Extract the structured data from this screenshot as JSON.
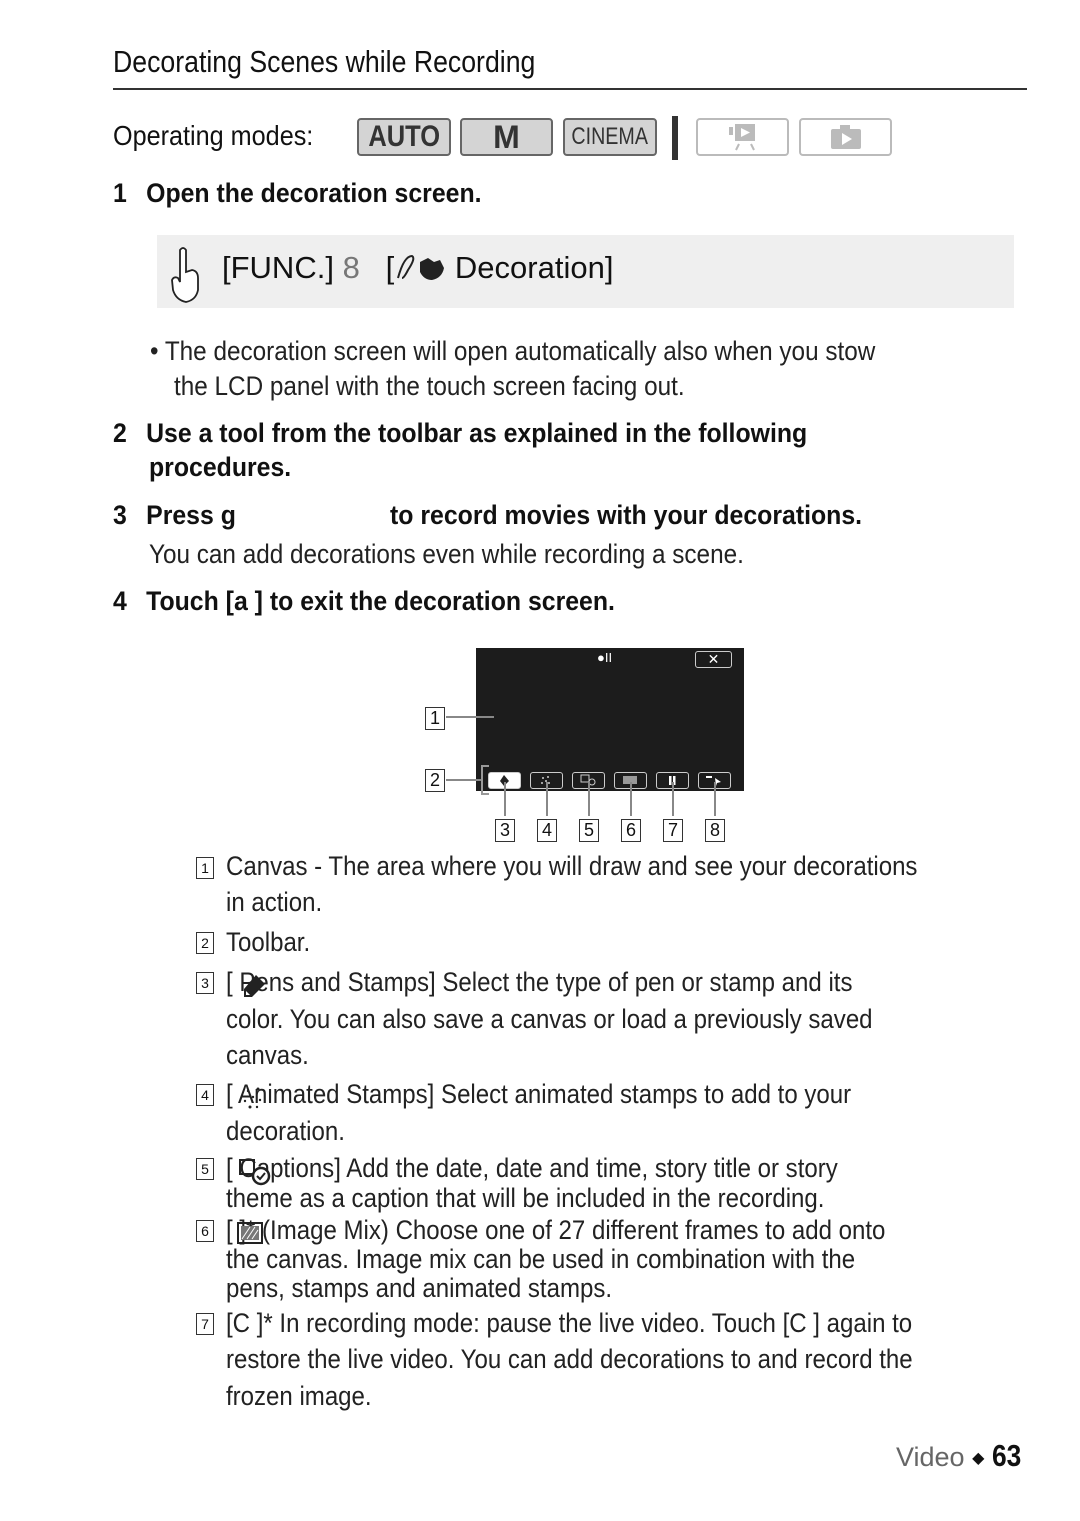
{
  "page": {
    "title": "Decorating Scenes while Recording",
    "operating_modes": {
      "label": "Operating modes:",
      "modes": [
        {
          "label": "AUTO",
          "enabled": true
        },
        {
          "label": "M",
          "enabled": true
        },
        {
          "label": "CINEMA",
          "enabled": true
        },
        {
          "label": "video-playback-icon",
          "enabled": false
        },
        {
          "label": "photo-playback-icon",
          "enabled": false
        }
      ]
    },
    "steps": [
      {
        "num": "1",
        "text": "Open the decoration screen."
      },
      {
        "num": "2",
        "text_line1": "Use a tool from the toolbar as explained in the following",
        "text_line2": "procedures."
      },
      {
        "num": "3",
        "text_a": "Press g",
        "text_b": "to record movies with your decorations.",
        "sub": "You can add decorations even while recording a scene."
      },
      {
        "num": "4",
        "text": "Touch [a  ] to exit the decoration screen."
      }
    ],
    "func_box": {
      "func": "[FUNC.]",
      "arrow": "8",
      "menu_open": "[",
      "menu": "Decoration]"
    },
    "bullet": {
      "line1": "The decoration screen will open automatically also when you stow",
      "line2": "the LCD panel with the touch screen facing out."
    },
    "diagram": {
      "status": "●II",
      "close": "✕",
      "callouts": [
        "1",
        "2",
        "3",
        "4",
        "5",
        "6",
        "7",
        "8"
      ]
    },
    "legend": [
      {
        "num": "1",
        "lines": [
          "Canvas - The area where you will draw and see your decorations",
          "in action."
        ]
      },
      {
        "num": "2",
        "lines": [
          "Toolbar."
        ]
      },
      {
        "num": "3",
        "lines": [
          "[  Pens and Stamps] Select the type of pen or stamp and its",
          "color. You can also save a canvas or load a previously saved",
          "canvas."
        ]
      },
      {
        "num": "4",
        "lines": [
          "[  Animated Stamps] Select animated stamps to add to your",
          "decoration."
        ]
      },
      {
        "num": "5",
        "lines": [
          "[   Captions] Add the date, date and time, story title or story",
          "theme as a caption that will be included in the recording."
        ]
      },
      {
        "num": "6",
        "lines": [
          "[   ]* (Image Mix) Choose one of 27 different frames to add onto",
          "the canvas. Image mix can be used in combination with the",
          "pens, stamps and animated stamps."
        ]
      },
      {
        "num": "7",
        "lines": [
          "[C  ]* In recording mode: pause the live video. Touch [C  ] again to",
          "restore the live video. You can add decorations to and record the",
          "frozen image."
        ]
      }
    ],
    "footer": {
      "section": "Video",
      "separator": "◆",
      "page_number": "63"
    }
  }
}
